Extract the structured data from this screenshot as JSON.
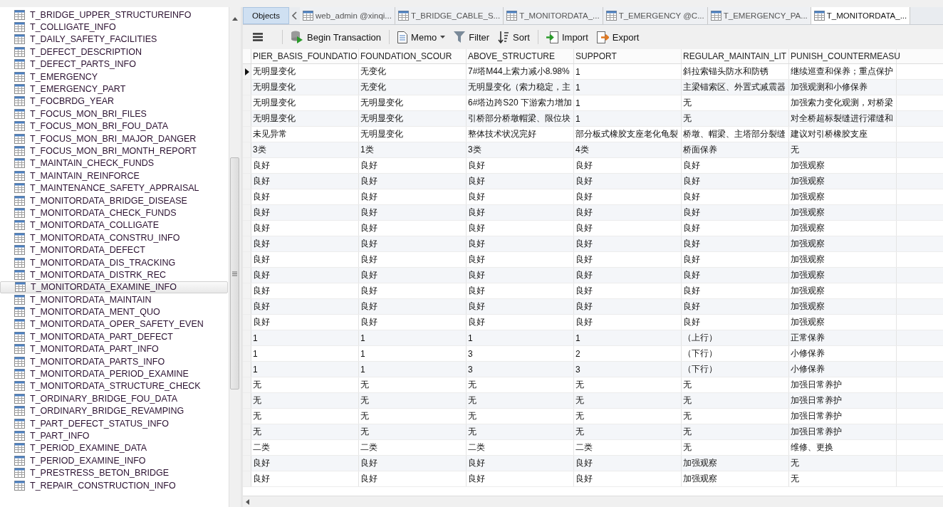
{
  "sidebar": {
    "items": [
      {
        "label": "T_BRIDGE_UPPER_STRUCTUREINFO",
        "selected": false
      },
      {
        "label": "T_COLLIGATE_INFO",
        "selected": false
      },
      {
        "label": "T_DAILY_SAFETY_FACILITIES",
        "selected": false
      },
      {
        "label": "T_DEFECT_DESCRIPTION",
        "selected": false
      },
      {
        "label": "T_DEFECT_PARTS_INFO",
        "selected": false
      },
      {
        "label": "T_EMERGENCY",
        "selected": false
      },
      {
        "label": "T_EMERGENCY_PART",
        "selected": false
      },
      {
        "label": "T_FOCBRDG_YEAR",
        "selected": false
      },
      {
        "label": "T_FOCUS_MON_BRI_FILES",
        "selected": false
      },
      {
        "label": "T_FOCUS_MON_BRI_FOU_DATA",
        "selected": false
      },
      {
        "label": "T_FOCUS_MON_BRI_MAJOR_DANGER",
        "selected": false
      },
      {
        "label": "T_FOCUS_MON_BRI_MONTH_REPORT",
        "selected": false
      },
      {
        "label": "T_MAINTAIN_CHECK_FUNDS",
        "selected": false
      },
      {
        "label": "T_MAINTAIN_REINFORCE",
        "selected": false
      },
      {
        "label": "T_MAINTENANCE_SAFETY_APPRAISAL",
        "selected": false
      },
      {
        "label": "T_MONITORDATA_BRIDGE_DISEASE",
        "selected": false
      },
      {
        "label": "T_MONITORDATA_CHECK_FUNDS",
        "selected": false
      },
      {
        "label": "T_MONITORDATA_COLLIGATE",
        "selected": false
      },
      {
        "label": "T_MONITORDATA_CONSTRU_INFO",
        "selected": false
      },
      {
        "label": "T_MONITORDATA_DEFECT",
        "selected": false
      },
      {
        "label": "T_MONITORDATA_DIS_TRACKING",
        "selected": false
      },
      {
        "label": "T_MONITORDATA_DISTRK_REC",
        "selected": false
      },
      {
        "label": "T_MONITORDATA_EXAMINE_INFO",
        "selected": true
      },
      {
        "label": "T_MONITORDATA_MAINTAIN",
        "selected": false
      },
      {
        "label": "T_MONITORDATA_MENT_QUO",
        "selected": false
      },
      {
        "label": "T_MONITORDATA_OPER_SAFETY_EVEN",
        "selected": false
      },
      {
        "label": "T_MONITORDATA_PART_DEFECT",
        "selected": false
      },
      {
        "label": "T_MONITORDATA_PART_INFO",
        "selected": false
      },
      {
        "label": "T_MONITORDATA_PARTS_INFO",
        "selected": false
      },
      {
        "label": "T_MONITORDATA_PERIOD_EXAMINE",
        "selected": false
      },
      {
        "label": "T_MONITORDATA_STRUCTURE_CHECK",
        "selected": false
      },
      {
        "label": "T_ORDINARY_BRIDGE_FOU_DATA",
        "selected": false
      },
      {
        "label": "T_ORDINARY_BRIDGE_REVAMPING",
        "selected": false
      },
      {
        "label": "T_PART_DEFECT_STATUS_INFO",
        "selected": false
      },
      {
        "label": "T_PART_INFO",
        "selected": false
      },
      {
        "label": "T_PERIOD_EXAMINE_DATA",
        "selected": false
      },
      {
        "label": "T_PERIOD_EXAMINE_INFO",
        "selected": false
      },
      {
        "label": "T_PRESTRESS_BETON_BRIDGE",
        "selected": false
      },
      {
        "label": "T_REPAIR_CONSTRUCTION_INFO",
        "selected": false
      }
    ]
  },
  "tabs": [
    {
      "label": "Objects",
      "kind": "objects",
      "selected": false
    },
    {
      "label": "web_admin @xinqi...",
      "kind": "table",
      "selected": false
    },
    {
      "label": "T_BRIDGE_CABLE_S...",
      "kind": "table",
      "selected": false
    },
    {
      "label": "T_MONITORDATA_...",
      "kind": "table",
      "selected": false
    },
    {
      "label": "T_EMERGENCY @C...",
      "kind": "table",
      "selected": false
    },
    {
      "label": "T_EMERGENCY_PA...",
      "kind": "table",
      "selected": false
    },
    {
      "label": "T_MONITORDATA_...",
      "kind": "table",
      "selected": true
    }
  ],
  "toolbar": [
    {
      "kind": "menu"
    },
    {
      "kind": "transaction",
      "label": "Begin Transaction"
    },
    {
      "kind": "memo",
      "label": "Memo",
      "dropdown": true
    },
    {
      "kind": "filter",
      "label": "Filter"
    },
    {
      "kind": "sort",
      "label": "Sort"
    },
    {
      "kind": "import",
      "label": "Import"
    },
    {
      "kind": "export",
      "label": "Export"
    }
  ],
  "table": {
    "columns": [
      "PIER_BASIS_FOUNDATIO",
      "FOUNDATION_SCOUR",
      "ABOVE_STRUCTURE",
      "SUPPORT",
      "REGULAR_MAINTAIN_LIT",
      "PUNISH_COUNTERMEASU"
    ],
    "rows": [
      {
        "current": true,
        "cells": [
          "无明显变化",
          "无变化",
          "7#塔M44上索力减小8.98%",
          "1",
          "斜拉索锚头防水和防锈",
          "继续巡查和保养；重点保护"
        ]
      },
      {
        "current": false,
        "cells": [
          "无明显变化",
          "无变化",
          "无明显变化（索力稳定，主",
          "1",
          "主梁锚索区、外置式减震器",
          "加强观测和小修保养"
        ]
      },
      {
        "current": false,
        "cells": [
          "无明显变化",
          "无明显变化",
          "6#塔边跨S20 下游索力增加",
          "1",
          "无",
          "加强索力变化观测，对桥梁"
        ]
      },
      {
        "current": false,
        "cells": [
          "无明显变化",
          "无明显变化",
          "引桥部分桥墩帽梁、限位块",
          "1",
          "无",
          "对全桥超标裂缝进行灌缝和"
        ]
      },
      {
        "current": false,
        "cells": [
          "未见异常",
          "无明显变化",
          "整体技术状况完好",
          "部分板式橡胶支座老化龟裂",
          "桥墩、帽梁、主塔部分裂缝",
          "建议对引桥橡胶支座"
        ]
      },
      {
        "current": false,
        "cells": [
          "3类",
          "1类",
          "3类",
          "4类",
          "桥面保养",
          "无"
        ]
      },
      {
        "current": false,
        "cells": [
          "良好",
          "良好",
          "良好",
          "良好",
          "良好",
          "加强观察"
        ]
      },
      {
        "current": false,
        "cells": [
          "良好",
          "良好",
          "良好",
          "良好",
          "良好",
          "加强观察"
        ]
      },
      {
        "current": false,
        "cells": [
          "良好",
          "良好",
          "良好",
          "良好",
          "良好",
          "加强观察"
        ]
      },
      {
        "current": false,
        "cells": [
          "良好",
          "良好",
          "良好",
          "良好",
          "良好",
          "加强观察"
        ]
      },
      {
        "current": false,
        "cells": [
          "良好",
          "良好",
          "良好",
          "良好",
          "良好",
          "加强观察"
        ]
      },
      {
        "current": false,
        "cells": [
          "良好",
          "良好",
          "良好",
          "良好",
          "良好",
          "加强观察"
        ]
      },
      {
        "current": false,
        "cells": [
          "良好",
          "良好",
          "良好",
          "良好",
          "良好",
          "加强观察"
        ]
      },
      {
        "current": false,
        "cells": [
          "良好",
          "良好",
          "良好",
          "良好",
          "良好",
          "加强观察"
        ]
      },
      {
        "current": false,
        "cells": [
          "良好",
          "良好",
          "良好",
          "良好",
          "良好",
          "加强观察"
        ]
      },
      {
        "current": false,
        "cells": [
          "良好",
          "良好",
          "良好",
          "良好",
          "良好",
          "加强观察"
        ]
      },
      {
        "current": false,
        "cells": [
          "良好",
          "良好",
          "良好",
          "良好",
          "良好",
          "加强观察"
        ]
      },
      {
        "current": false,
        "cells": [
          "1",
          "1",
          "1",
          "1",
          "（上行）",
          "正常保养"
        ]
      },
      {
        "current": false,
        "cells": [
          "1",
          "1",
          "3",
          "2",
          "（下行）",
          "小修保养"
        ]
      },
      {
        "current": false,
        "cells": [
          "1",
          "1",
          "3",
          "3",
          "（下行）",
          "小修保养"
        ]
      },
      {
        "current": false,
        "cells": [
          "无",
          "无",
          "无",
          "无",
          "无",
          "加强日常养护"
        ]
      },
      {
        "current": false,
        "cells": [
          "无",
          "无",
          "无",
          "无",
          "无",
          "加强日常养护"
        ]
      },
      {
        "current": false,
        "cells": [
          "无",
          "无",
          "无",
          "无",
          "无",
          "加强日常养护"
        ]
      },
      {
        "current": false,
        "cells": [
          "无",
          "无",
          "无",
          "无",
          "无",
          "加强日常养护"
        ]
      },
      {
        "current": false,
        "cells": [
          "二类",
          "二类",
          "二类",
          "二类",
          "无",
          "维修、更换"
        ]
      },
      {
        "current": false,
        "cells": [
          "良好",
          "良好",
          "良好",
          "良好",
          "加强观察",
          "无"
        ]
      },
      {
        "current": false,
        "cells": [
          "良好",
          "良好",
          "良好",
          "良好",
          "加强观察",
          "无"
        ]
      }
    ]
  }
}
